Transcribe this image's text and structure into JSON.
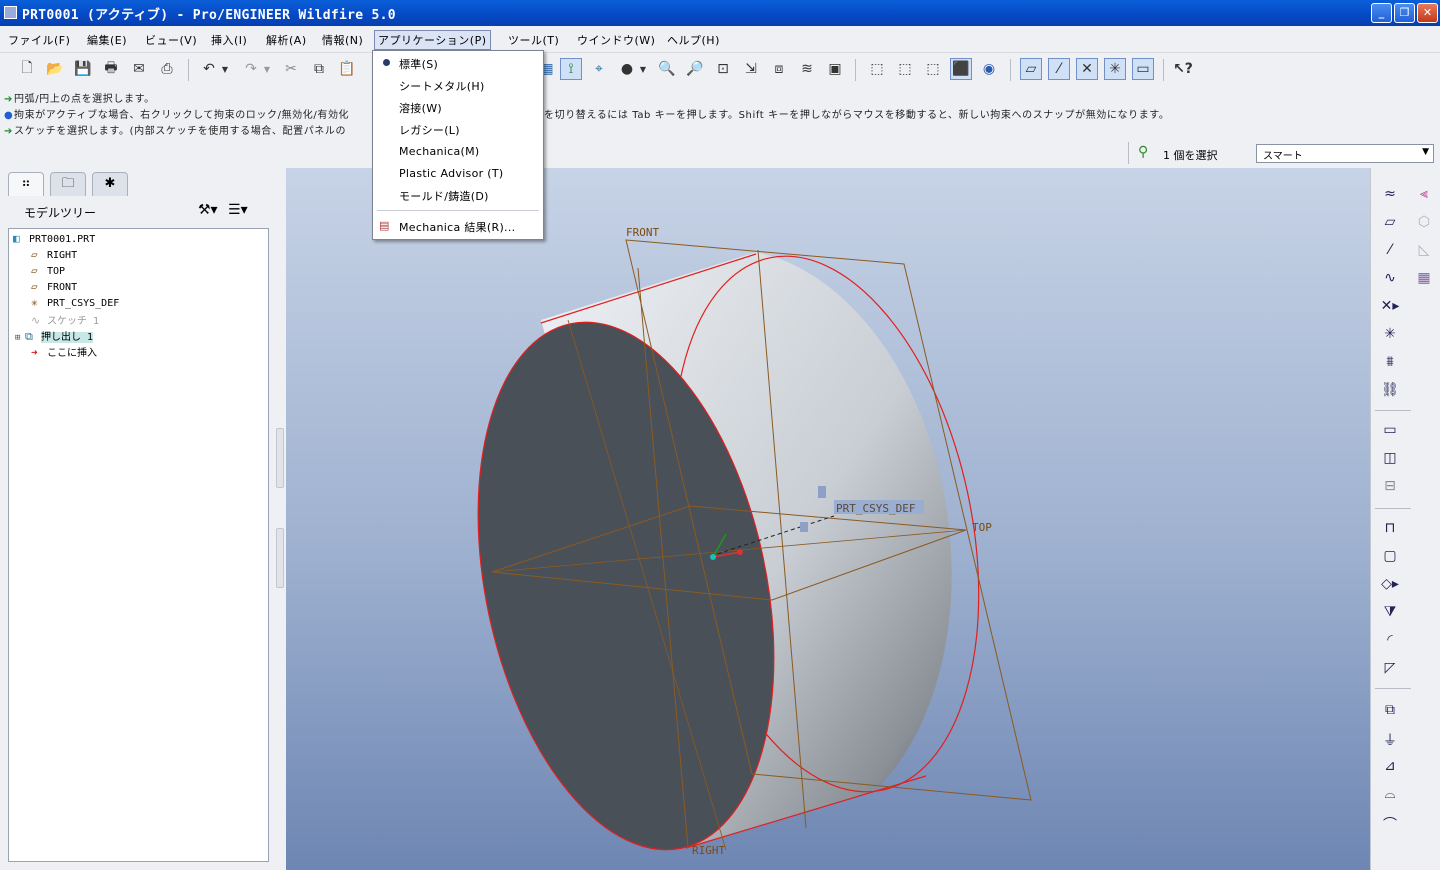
{
  "window": {
    "title": "PRT0001 (アクティブ) - Pro/ENGINEER Wildfire 5.0",
    "minimize": "_",
    "restore": "❐",
    "close": "✕"
  },
  "menubar": {
    "items": [
      {
        "label": "ファイル(F)"
      },
      {
        "label": "編集(E)"
      },
      {
        "label": "ビュー(V)"
      },
      {
        "label": "挿入(I)"
      },
      {
        "label": "解析(A)"
      },
      {
        "label": "情報(N)"
      },
      {
        "label": "アプリケーション(P)"
      },
      {
        "label": "ツール(T)"
      },
      {
        "label": "ウインドウ(W)"
      },
      {
        "label": "ヘルプ(H)"
      }
    ]
  },
  "app_menu": {
    "items": [
      {
        "label": "標準(S)",
        "selected": true
      },
      {
        "label": "シートメタル(H)"
      },
      {
        "label": "溶接(W)"
      },
      {
        "label": "レガシー(L)"
      },
      {
        "label": "Mechanica(M)"
      },
      {
        "label": "Plastic Advisor (T)"
      },
      {
        "label": "モールド/鋳造(D)"
      }
    ],
    "results_label": "Mechanica 結果(R)..."
  },
  "messages": [
    {
      "icon": "arrow",
      "text": "円弧/円上の点を選択します。"
    },
    {
      "icon": "info",
      "text": "拘束がアクティブな場合、右クリックして拘束のロック/無効化/有効化"
    },
    {
      "icon": "arrow",
      "text": "スケッチを選択します。(内部スケッチを使用する場合、配置パネルの"
    }
  ],
  "messages_right": "を切り替えるには Tab キーを押します。Shift キーを押しながらマウスを移動すると、新しい拘束へのスナップが無効になります。",
  "status": {
    "selection_count": "1 個を選択",
    "filter": "スマート"
  },
  "navigator": {
    "title": "モデルツリー",
    "tree": [
      {
        "label": "PRT0001.PRT",
        "icon": "part-icon"
      },
      {
        "label": "RIGHT",
        "icon": "datum-plane-icon"
      },
      {
        "label": "TOP",
        "icon": "datum-plane-icon"
      },
      {
        "label": "FRONT",
        "icon": "datum-plane-icon"
      },
      {
        "label": "PRT_CSYS_DEF",
        "icon": "csys-icon"
      },
      {
        "label": "スケッチ 1",
        "icon": "sketch-icon",
        "dimmed": true
      },
      {
        "label": "押し出し 1",
        "icon": "extrude-icon",
        "highlighted": true
      },
      {
        "label": "ここに挿入",
        "icon": "insert-here-icon"
      }
    ]
  },
  "graphics": {
    "labels": {
      "front": "FRONT",
      "top": "TOP",
      "csys": "PRT_CSYS_DEF",
      "right": "RIGHT"
    },
    "colors": {
      "plane": "#8a5a22",
      "edge": "#e02020",
      "face": "#4a5057"
    }
  }
}
